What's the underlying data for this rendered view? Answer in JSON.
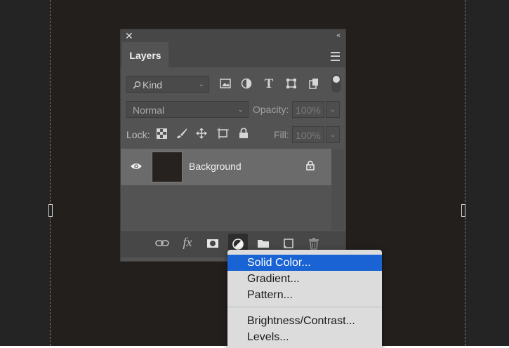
{
  "panel": {
    "close_glyph": "✕",
    "collapse_glyph": "‹‹",
    "tab_label": "Layers",
    "menu_icon": "panel-menu-icon"
  },
  "filter": {
    "kind_value": "Kind",
    "kind_icon": "search-icon"
  },
  "blend": {
    "mode_value": "Normal",
    "opacity_label": "Opacity:",
    "opacity_value": "100%"
  },
  "lock": {
    "label": "Lock:",
    "fill_label": "Fill:",
    "fill_value": "100%"
  },
  "layers": [
    {
      "name": "Background",
      "visible": true,
      "locked": true
    }
  ],
  "bottom_icons": [
    "link-icon",
    "fx-icon",
    "mask-icon",
    "adjustment-icon",
    "folder-icon",
    "new-layer-icon",
    "trash-icon"
  ],
  "fx_glyph": "fx",
  "dropdown": {
    "items": [
      {
        "label": "Solid Color...",
        "selected": true
      },
      {
        "label": "Gradient...",
        "selected": false
      },
      {
        "label": "Pattern...",
        "selected": false
      },
      {
        "label": "Brightness/Contrast...",
        "selected": false
      },
      {
        "label": "Levels...",
        "selected": false
      }
    ]
  },
  "colors": {
    "selection": "#1a63d5",
    "panel_bg": "#535353",
    "canvas_bg": "#231f1d"
  }
}
